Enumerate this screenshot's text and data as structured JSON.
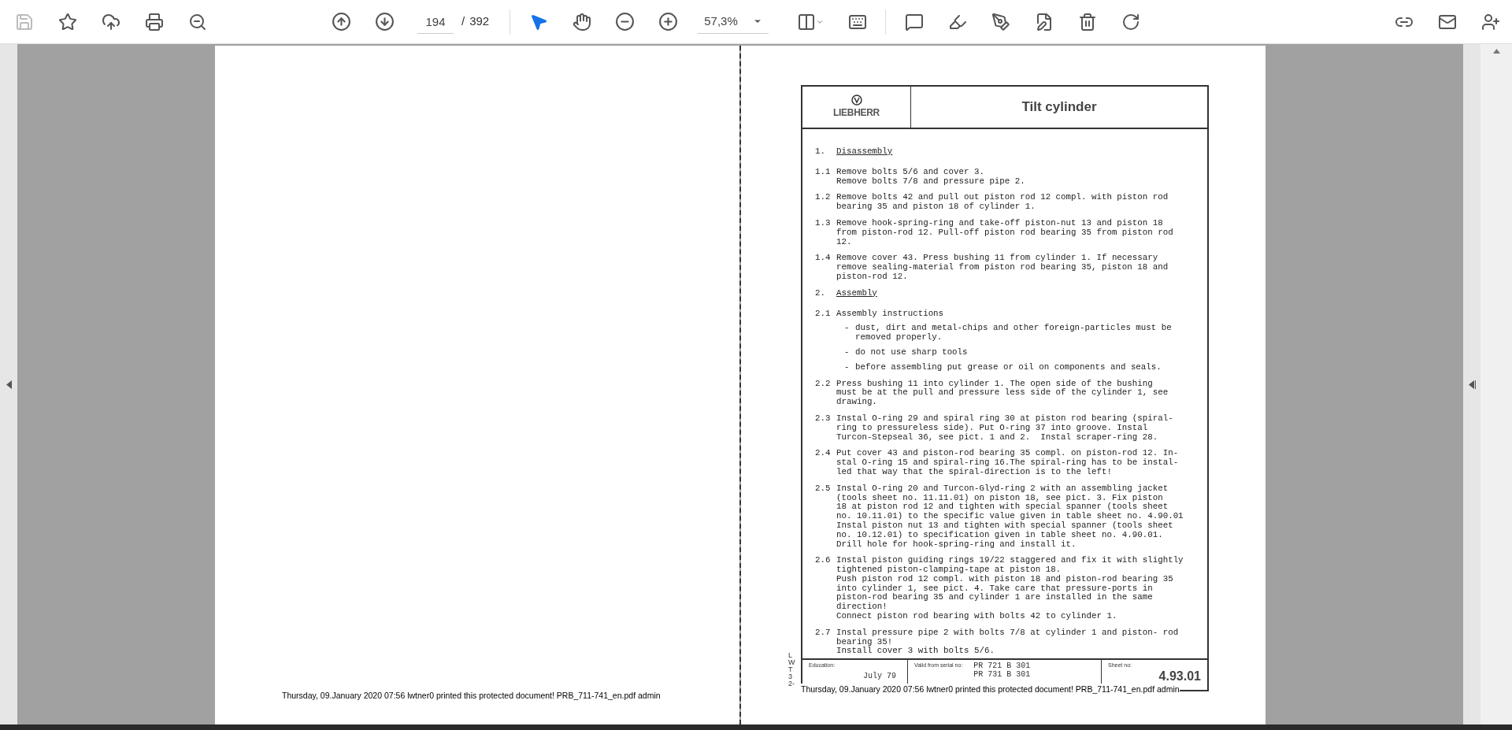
{
  "toolbar": {
    "page": {
      "current": "194",
      "separator": "/",
      "total": "392"
    },
    "zoom": "57,3%",
    "tools": [
      {
        "selected": true
      },
      {
        "selected": false
      }
    ]
  },
  "left_page": {
    "print_notice": "Thursday, 09.January 2020 07:56 lwtner0 printed this protected document! PRB_711-741_en.pdf admin"
  },
  "right_page": {
    "header": {
      "logo_text": "LIEBHERR",
      "title": "Tilt cylinder"
    },
    "sections": [
      {
        "number": "1.",
        "heading": "Disassembly",
        "items": [
          {
            "number": "1.1",
            "lines": [
              "Remove bolts 5/6 and cover 3.",
              "Remove bolts 7/8 and pressure pipe 2."
            ]
          },
          {
            "number": "1.2",
            "lines": [
              "Remove bolts 42 and pull out piston rod 12 compl. with piston rod",
              "bearing 35 and piston 18 of cylinder 1."
            ]
          },
          {
            "number": "1.3",
            "lines": [
              "Remove hook-spring-ring and take-off piston-nut 13 and piston 18",
              "from piston-rod 12. Pull-off piston rod bearing 35 from piston rod",
              "12."
            ]
          },
          {
            "number": "1.4",
            "lines": [
              "Remove cover 43. Press bushing 11 from cylinder 1. If necessary",
              "remove sealing-material from piston rod bearing 35, piston 18 and",
              "piston-rod 12."
            ]
          }
        ]
      },
      {
        "number": "2.",
        "heading": "Assembly",
        "items": [
          {
            "number": "2.1",
            "lines": [
              "Assembly instructions"
            ],
            "bullets": [
              {
                "marker": "-",
                "lines": [
                  "dust, dirt and metal-chips and other foreign-particles must be",
                  "removed properly."
                ]
              },
              {
                "marker": "-",
                "lines": [
                  "do not use sharp tools"
                ]
              },
              {
                "marker": "-",
                "lines": [
                  "before assembling put grease or oil on components and seals."
                ]
              }
            ]
          },
          {
            "number": "2.2",
            "lines": [
              "Press bushing 11 into cylinder 1. The open side of the bushing",
              "must be at the pull and pressure less side of the cylinder 1, see",
              "drawing."
            ]
          },
          {
            "number": "2.3",
            "lines": [
              "Instal O-ring 29 and spiral ring 30 at piston rod bearing (spiral-",
              "ring to pressureless side). Put O-ring 37 into groove. Instal",
              "Turcon-Stepseal 36, see pict. 1 and 2.  Instal scraper-ring 28."
            ]
          },
          {
            "number": "2.4",
            "lines": [
              "Put cover 43 and piston-rod bearing 35 compl. on piston-rod 12. In-",
              "stal O-ring 15 and spiral-ring 16.The spiral-ring has to be instal-",
              "led that way that the spiral-direction is to the left!"
            ]
          },
          {
            "number": "2.5",
            "lines": [
              "Instal O-ring 20 and Turcon-Glyd-ring 2 with an assembling jacket",
              "(tools sheet no. 11.11.01) on piston 18, see pict. 3. Fix piston",
              "18 at piston rod 12 and tighten with special spanner (tools sheet",
              "no. 10.11.01) to the specific value given in table sheet no. 4.90.01",
              "Instal piston nut 13 and tighten with special spanner (tools sheet",
              "no. 10.12.01) to specification given in table sheet no. 4.90.01.",
              "Drill hole for hook-spring-ring and install it."
            ]
          },
          {
            "number": "2.6",
            "lines": [
              "Instal piston guiding rings 19/22 staggered and fix it with slightly",
              "tightened piston-clamping-tape at piston 18.",
              "Push piston rod 12 compl. with piston 18 and piston-rod bearing 35",
              "into cylinder 1, see pict. 4. Take care that pressure-ports in",
              "piston-rod bearing 35 and cylinder 1 are installed in the same",
              "direction!",
              "Connect piston rod bearing with bolts 42 to cylinder 1."
            ]
          },
          {
            "number": "2.7",
            "lines": [
              "Instal pressure pipe 2 with bolts 7/8 at cylinder 1 and piston- rod",
              "bearing 35!",
              "Install cover 3 with bolts 5/6."
            ]
          }
        ]
      }
    ],
    "footer": {
      "education_label": "Education:",
      "education_value": "July 79",
      "valid_label": "Valid from serial no:",
      "serials": [
        "PR 721 B 301",
        "PR 731 B 301"
      ],
      "sheet_label": "Sheet no:",
      "sheet_value": "4.93.01"
    },
    "side_code": "LWT 32-",
    "print_notice": "Thursday, 09.January 2020 07:56 lwtner0 printed this protected document! PRB_711-741_en.pdf admin"
  }
}
